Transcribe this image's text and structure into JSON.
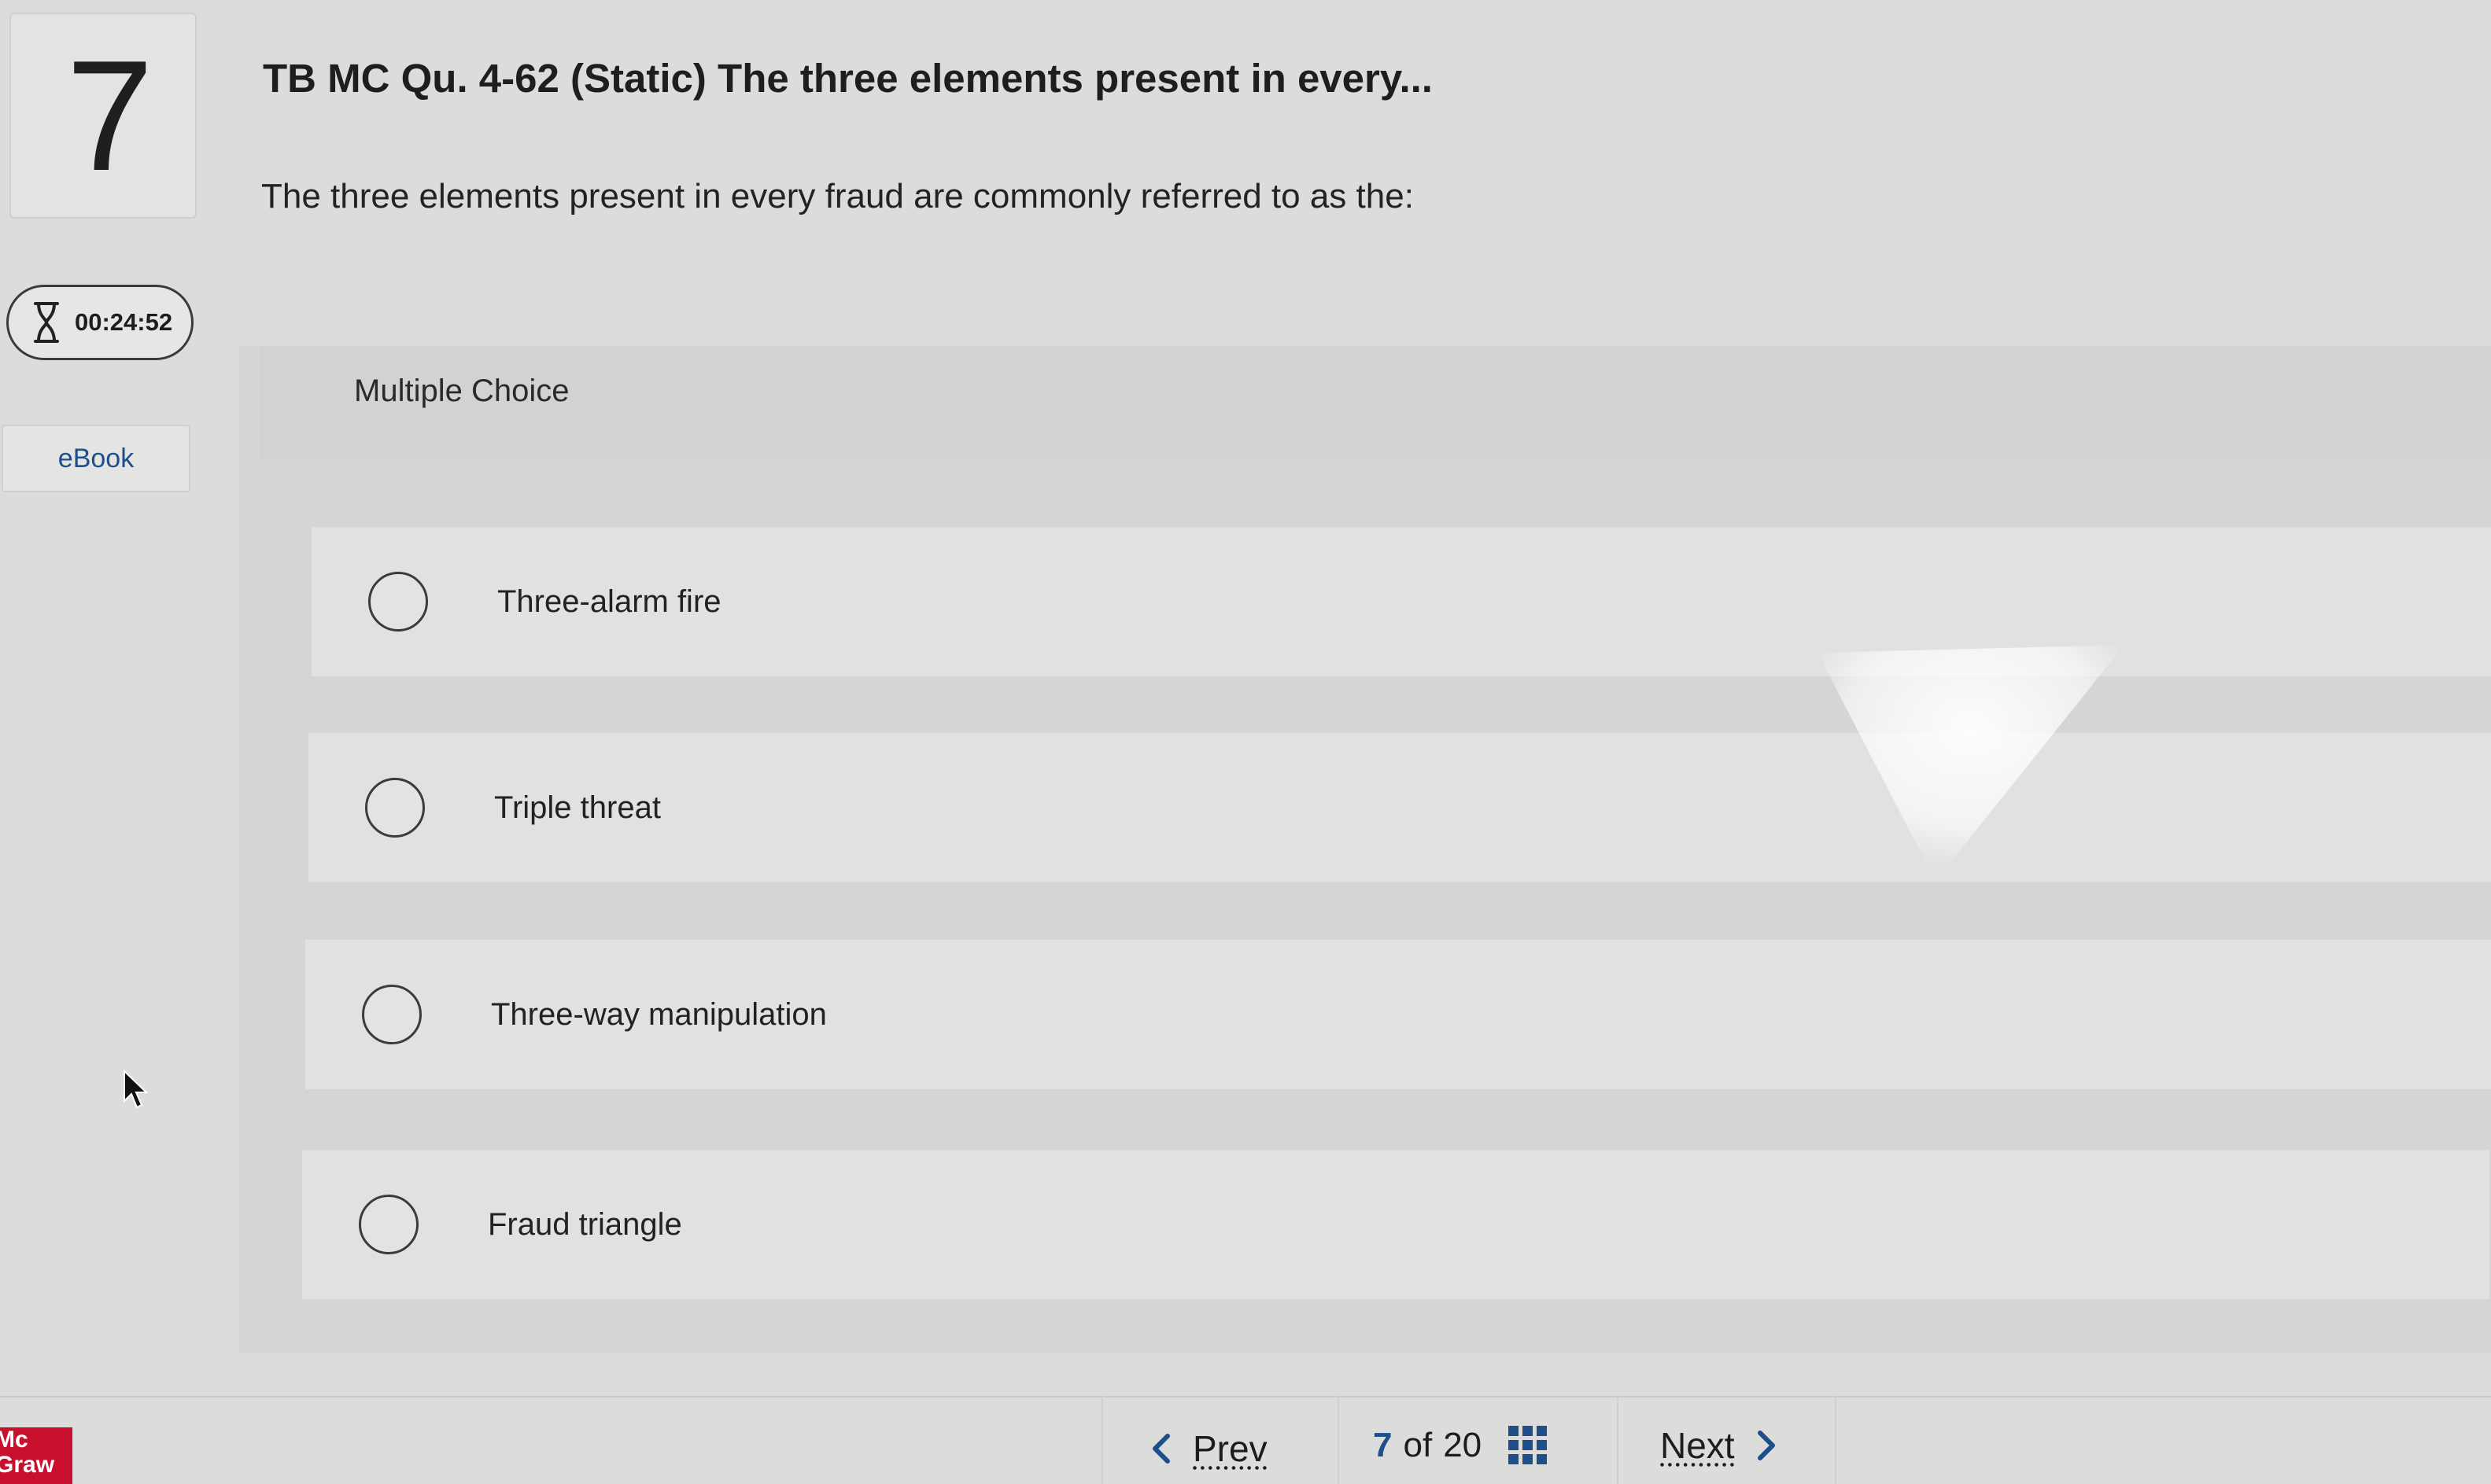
{
  "question": {
    "number": "7",
    "title": "TB MC Qu. 4-62 (Static) The three elements present in every...",
    "prompt": "The three elements present in every fraud are commonly referred to as the:"
  },
  "sidebar": {
    "timer": "00:24:52",
    "ebook_label": "eBook"
  },
  "multiple_choice": {
    "label": "Multiple Choice",
    "options": [
      {
        "label": "Three-alarm fire",
        "selected": false
      },
      {
        "label": "Triple threat",
        "selected": false
      },
      {
        "label": "Three-way manipulation",
        "selected": false
      },
      {
        "label": "Fraud triangle",
        "selected": false
      }
    ]
  },
  "footer": {
    "logo_lines": [
      "Mc",
      "Graw"
    ],
    "prev_label": "Prev",
    "current_page": "7",
    "of_label": "of",
    "total_pages": "20",
    "next_label": "Next"
  },
  "icons": {
    "timer": "hourglass-icon",
    "prev": "chevron-left-icon",
    "next": "chevron-right-icon",
    "grid": "grid-icon",
    "cursor": "mouse-cursor-icon"
  },
  "colors": {
    "link_blue": "#1f4f8a",
    "brand_red": "#c8102e"
  }
}
